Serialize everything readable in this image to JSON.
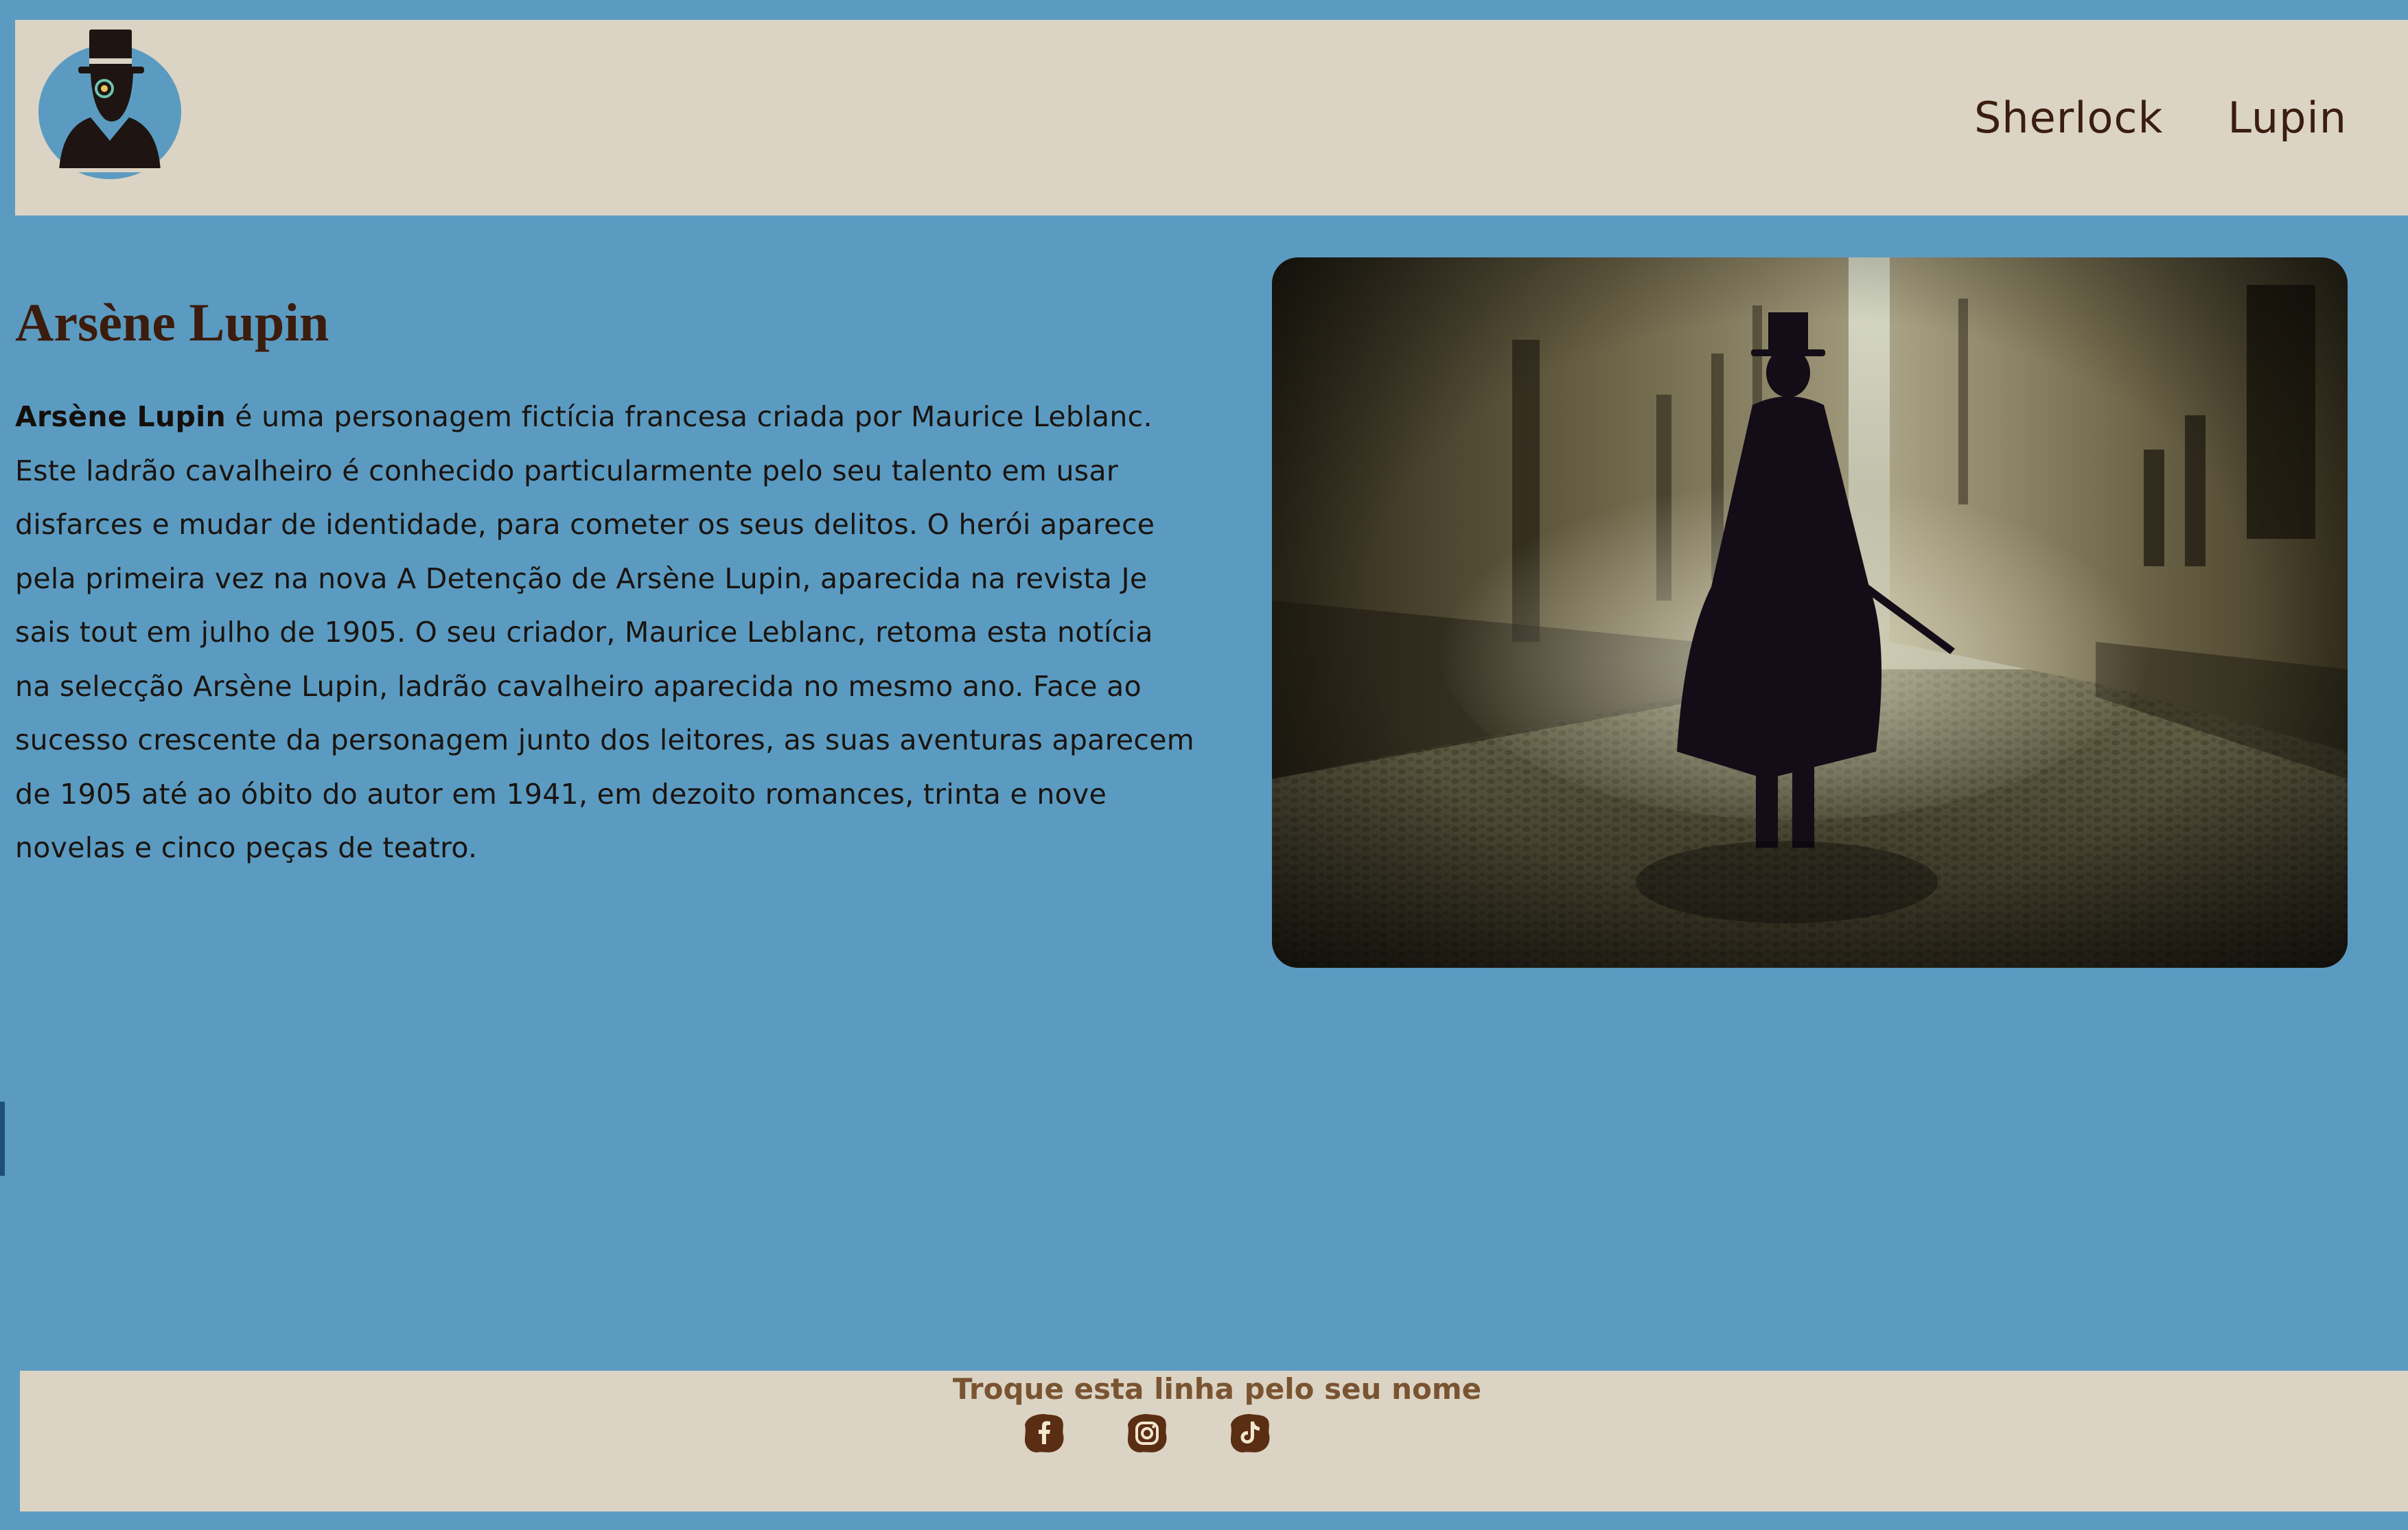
{
  "header": {
    "logo_alt": "detective logo",
    "nav": [
      {
        "label": "Sherlock"
      },
      {
        "label": "Lupin"
      }
    ]
  },
  "main": {
    "title": "Arsène Lupin",
    "bio_bold": "Arsène Lupin",
    "bio_text": " é uma personagem fictícia francesa criada por Maurice Leblanc. Este ladrão cavalheiro é conhecido particularmente pelo seu talento em usar disfarces e mudar de identidade, para cometer os seus delitos. O herói aparece pela primeira vez na nova A Detenção de Arsène Lupin, aparecida na revista Je sais tout em julho de 1905. O seu criador, Maurice Leblanc, retoma esta notícia na selecção Arsène Lupin, ladrão cavalheiro aparecida no mesmo ano. Face ao sucesso crescente da personagem junto dos leitores, as suas aventuras aparecem de 1905 até ao óbito do autor em 1941, em dezoito romances, trinta e nove novelas e cinco peças de teatro.",
    "image_alt": "silhouette of man in top hat walking down a foggy cobblestone alley"
  },
  "footer": {
    "name": "Troque esta linha pelo seu nome",
    "socials": [
      {
        "icon": "facebook-icon"
      },
      {
        "icon": "instagram-icon"
      },
      {
        "icon": "tiktok-icon"
      }
    ]
  },
  "colors": {
    "page_background": "#5b9bc1",
    "bar_background": "#dbd4c4",
    "heading": "#3b1c0d",
    "footer_text": "#7a5432",
    "social_icon": "#5a2e12"
  }
}
